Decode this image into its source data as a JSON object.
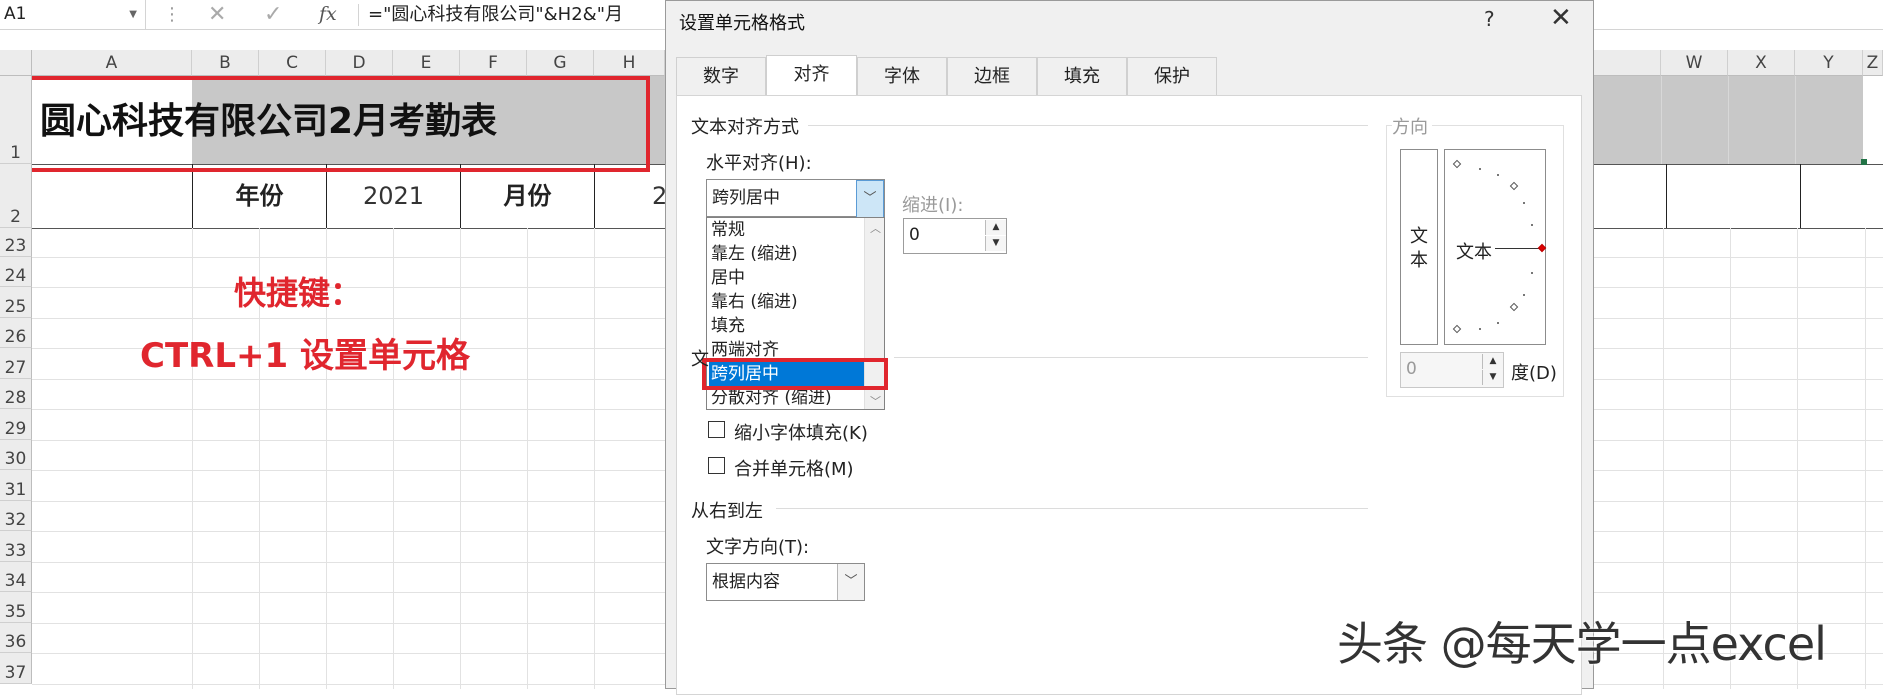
{
  "formula_bar": {
    "name_box": "A1",
    "name_box_icon": "chevron-down-icon",
    "separator": "⋮",
    "cancel_icon": "✕",
    "enter_icon": "✓",
    "fx_label": "fx",
    "formula": "=\"圆心科技有限公司\"&H2&\"月"
  },
  "sheet": {
    "columns": [
      "A",
      "B",
      "C",
      "D",
      "E",
      "F",
      "G",
      "H",
      "W",
      "X",
      "Y",
      "Z"
    ],
    "rows": [
      "1",
      "2",
      "23",
      "24",
      "25",
      "26",
      "27",
      "28",
      "29",
      "30",
      "31",
      "32",
      "33",
      "34",
      "35",
      "36",
      "37"
    ],
    "title": "圆心科技有限公司2月考勤表",
    "row2": {
      "year_label": "年份",
      "year_value": "2021",
      "month_label": "月份",
      "month_value_partial": "2"
    }
  },
  "annotation": {
    "shortcut_title": "快捷键：",
    "shortcut_text": "CTRL+1 设置单元格",
    "accent_color": "#e0262e"
  },
  "dialog": {
    "title": "设置单元格格式",
    "help": "?",
    "close": "✕",
    "tabs": [
      "数字",
      "对齐",
      "字体",
      "边框",
      "填充",
      "保护"
    ],
    "active_tab": "对齐",
    "text_alignment_group": "文本对齐方式",
    "horizontal_label": "水平对齐(H):",
    "horizontal_value": "跨列居中",
    "horizontal_options": [
      "常规",
      "靠左 (缩进)",
      "居中",
      "靠右 (缩进)",
      "填充",
      "两端对齐",
      "跨列居中",
      "分散对齐 (缩进)"
    ],
    "selected_option": "跨列居中",
    "indent_label": "缩进(I):",
    "indent_value": "0",
    "text_control_group_partial": "文",
    "shrink_label": "缩小字体填充(K)",
    "merge_label": "合并单元格(M)",
    "rtl_group": "从右到左",
    "text_direction_label": "文字方向(T):",
    "text_direction_value": "根据内容",
    "orientation_group": "方向",
    "orientation_vertical_text": [
      "文",
      "本"
    ],
    "orientation_dial_text": "文本",
    "degrees_value": "0",
    "degrees_label": "度(D)",
    "selection_highlight_color": "#0078d7"
  },
  "watermark": "头条 @每天学一点excel"
}
